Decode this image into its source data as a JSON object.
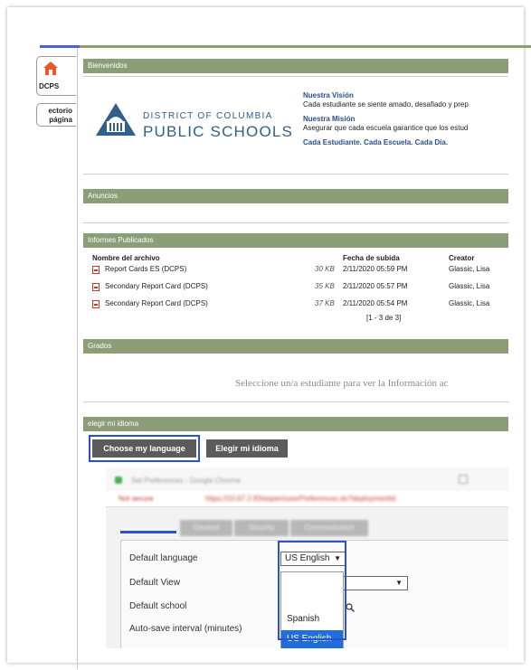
{
  "nav": {
    "home_tab": "DCPS",
    "directory_tab_line1": "ectorio",
    "directory_tab_line2": "página"
  },
  "sections": {
    "welcome": "Bienvenidos",
    "announcements": "Anuncios",
    "reports": "Informes Publicados",
    "grades": "Grados",
    "language": "elegir mi idioma"
  },
  "welcome": {
    "logo_line1": "DISTRICT OF COLUMBIA",
    "logo_line2": "PUBLIC SCHOOLS",
    "vision_title": "Nuestra Visión",
    "vision_text": "Cada estudiante se siente amado, desafiado y prep",
    "mission_title": "Nuestra Misión",
    "mission_text": "Asegurar que cada escuela garantice que los estud",
    "motto": "Cada Estudiante. Cada Escuela. Cada Día."
  },
  "reports": {
    "headers": {
      "name": "Nombre del archivo",
      "date": "Fecha de subida",
      "creator": "Creator"
    },
    "rows": [
      {
        "name": "Report Cards ES (DCPS)",
        "size": "30 KB",
        "date": "2/11/2020 05:59 PM",
        "creator": "Glassic, Lisa"
      },
      {
        "name": "Secondary Report Card (DCPS)",
        "size": "35 KB",
        "date": "2/11/2020 05:57 PM",
        "creator": "Glassic, Lisa"
      },
      {
        "name": "Secondary Report Card (DCPS)",
        "size": "37 KB",
        "date": "2/11/2020 05:54 PM",
        "creator": "Glassic, Lisa"
      }
    ],
    "pager": "[1 - 3 de 3]"
  },
  "grades": {
    "message": "Seleccione un/a estudiante para ver la Información ac"
  },
  "language": {
    "choose_button": "Choose my language",
    "elegir_button": "Elegir mi idioma"
  },
  "browser": {
    "window_title": "Set Preferences - Google Chrome",
    "not_secure": "Not secure",
    "url": "https://10.67.2.93/aspen/userPreferences.do?deploymentId",
    "tabs": [
      "General",
      "Security",
      "Communication"
    ],
    "prefs": {
      "default_language": "Default language",
      "default_view": "Default View",
      "default_school": "Default school",
      "autosave": "Auto-save interval (minutes)"
    },
    "language_value": "US English",
    "options": [
      "Spanish",
      "US English"
    ]
  },
  "colors": {
    "bar": "#8b9e77",
    "highlight": "#2a4fd8",
    "button": "#5b5b5b",
    "selected_option": "#1e6fd9",
    "logo": "#2f5f8a"
  }
}
